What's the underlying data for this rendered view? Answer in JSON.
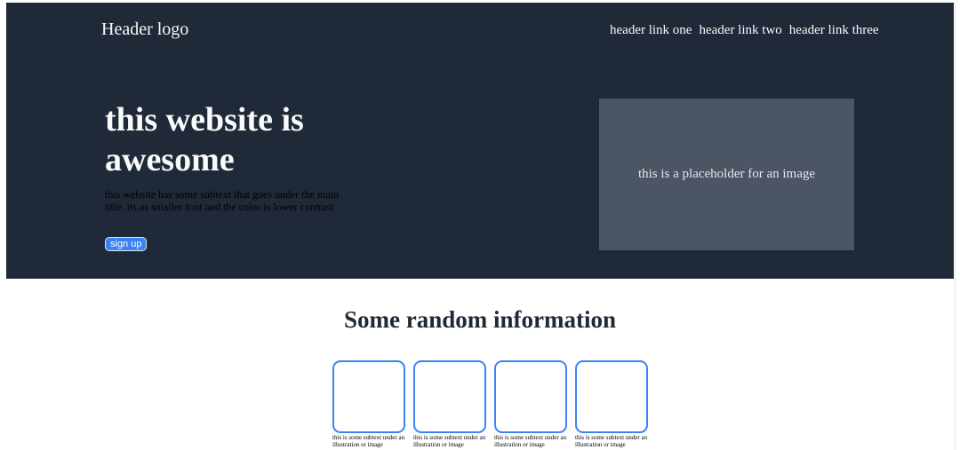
{
  "header": {
    "logo": "Header logo",
    "links": [
      "header link one",
      "header link two",
      "header link three"
    ]
  },
  "hero": {
    "title": "this website is awesome",
    "subtitle": "this website has some subtext that goes under the main title. its as smaller font and the color is lower contrast",
    "signup_label": "sign up",
    "image_placeholder": "this is a placeholder for an image"
  },
  "info": {
    "title": "Some random information",
    "cards": [
      {
        "text": "this is some subtext under an illustration or image"
      },
      {
        "text": "this is some subtext under an illustration or image"
      },
      {
        "text": "this is some subtext under an illustration or image"
      },
      {
        "text": "this is some subtext under an illustration or image"
      }
    ]
  },
  "colors": {
    "hero_background": "#1f2937",
    "placeholder_background": "#4b5563",
    "accent": "#3b82f6",
    "page_background": "#ffffff"
  }
}
